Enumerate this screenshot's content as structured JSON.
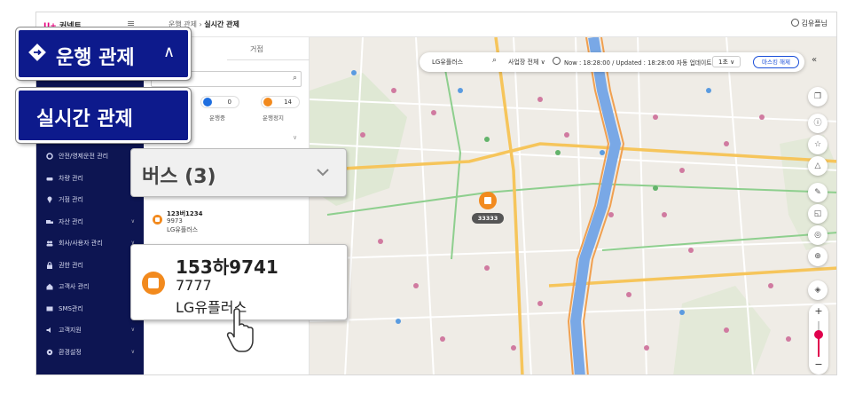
{
  "logo": {
    "mark": "U+",
    "text": "커넥트"
  },
  "breadcrumb": {
    "parent": "운행 관제",
    "sep": "›",
    "current": "실시간 관제"
  },
  "user": {
    "name": "김유플님"
  },
  "panel": {
    "tab_geojeom": "거점",
    "stats": [
      {
        "value": "0",
        "label": "운행중",
        "color": "#1f6fe0"
      },
      {
        "value": "14",
        "label": "운행정지",
        "color": "#f28a1e"
      }
    ],
    "bus_item": {
      "plate": "123버1234",
      "number": "9973",
      "company": "LG유플러스"
    }
  },
  "sidebar": {
    "items": [
      {
        "label": "안전/영제운전 관리",
        "icon": "gear-icon"
      },
      {
        "label": "차량 관리",
        "icon": "car-icon"
      },
      {
        "label": "거점 관리",
        "icon": "pin-icon"
      },
      {
        "label": "자산 관리",
        "icon": "truck-icon"
      },
      {
        "label": "회사/사용자 관리",
        "icon": "people-icon"
      },
      {
        "label": "권한 관리",
        "icon": "lock-icon"
      },
      {
        "label": "고객사 관리",
        "icon": "home-icon"
      },
      {
        "label": "SMS관리",
        "icon": "mail-icon"
      },
      {
        "label": "고객지원",
        "icon": "speaker-icon"
      },
      {
        "label": "환경설정",
        "icon": "settings-icon"
      }
    ]
  },
  "map_search": {
    "query": "LG유플러스",
    "filter": "사업장 전체",
    "status": "Now : 18:28:00 / Updated : 18:28:00 자동 업데이트",
    "interval": "1초",
    "marker_clear": "마스킹 해제"
  },
  "map": {
    "bus_marker_label": "33333",
    "colors": {
      "river": "#79a8e6",
      "road_main": "#f6c55b",
      "road_green": "#8ecf8e",
      "land": "#efece6"
    }
  },
  "callouts": {
    "operation": "운행 관제",
    "realtime": "실시간 관제",
    "bus_group": "버스 (3)",
    "bus_detail": {
      "plate": "153하9741",
      "number": "7777",
      "company": "LG유플러스"
    }
  }
}
